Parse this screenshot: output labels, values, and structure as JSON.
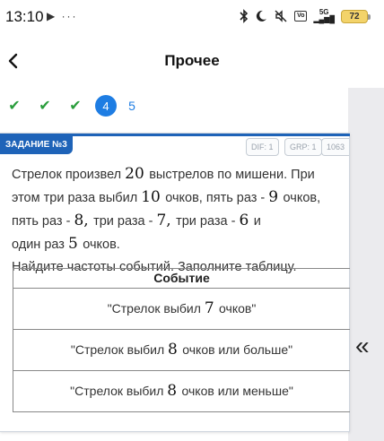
{
  "status_bar": {
    "time": "13:10",
    "left_icons": "▶ ···",
    "network_label": "5G",
    "box_label": "Vo",
    "battery": "72"
  },
  "header": {
    "title": "Прочее"
  },
  "steps": {
    "current": "4",
    "next": "5"
  },
  "task": {
    "label": "ЗАДАНИЕ №3",
    "meta": [
      "DIF: 1",
      "GRP: 1",
      "1063"
    ],
    "problem_lines": [
      [
        {
          "t": "Стрелок произвел "
        },
        {
          "m": "20"
        },
        {
          "t": " выстрелов по мишени. При"
        }
      ],
      [
        {
          "t": "этом три раза выбил "
        },
        {
          "m": "10"
        },
        {
          "t": " очков, пять раз - "
        },
        {
          "m": "9"
        },
        {
          "t": " очков,"
        }
      ],
      [
        {
          "t": "пять раз - "
        },
        {
          "m": "8,"
        },
        {
          "t": " три раза - "
        },
        {
          "m": "7,"
        },
        {
          "t": " три раза - "
        },
        {
          "m": "6"
        },
        {
          "t": " и"
        }
      ],
      [
        {
          "t": "один раз "
        },
        {
          "m": "5"
        },
        {
          "t": " очков."
        }
      ],
      [
        {
          "t": "Найдите частоты событий. Заполните таблицу."
        }
      ]
    ],
    "table": {
      "header": "Событие",
      "rows": [
        [
          {
            "t": "\"Стрелок выбил "
          },
          {
            "m": "7"
          },
          {
            "t": " очков\""
          }
        ],
        [
          {
            "t": "\"Стрелок выбил "
          },
          {
            "m": "8"
          },
          {
            "t": " очков или больше\""
          }
        ],
        [
          {
            "t": "\"Стрелок выбил "
          },
          {
            "m": "8"
          },
          {
            "t": " очков или меньше\""
          }
        ]
      ]
    }
  },
  "side_panel": {
    "collapse_glyph": "«"
  },
  "colors": {
    "accent": "#1e7de3",
    "task_label_bg": "#1e63b8",
    "check": "#2a9d3c",
    "panel": "#ebebee"
  },
  "icons": [
    "back-arrow-icon",
    "check-icon",
    "bluetooth-icon",
    "moon-icon",
    "mute-icon",
    "signal-icon",
    "battery-icon",
    "double-chevron-left-icon"
  ]
}
